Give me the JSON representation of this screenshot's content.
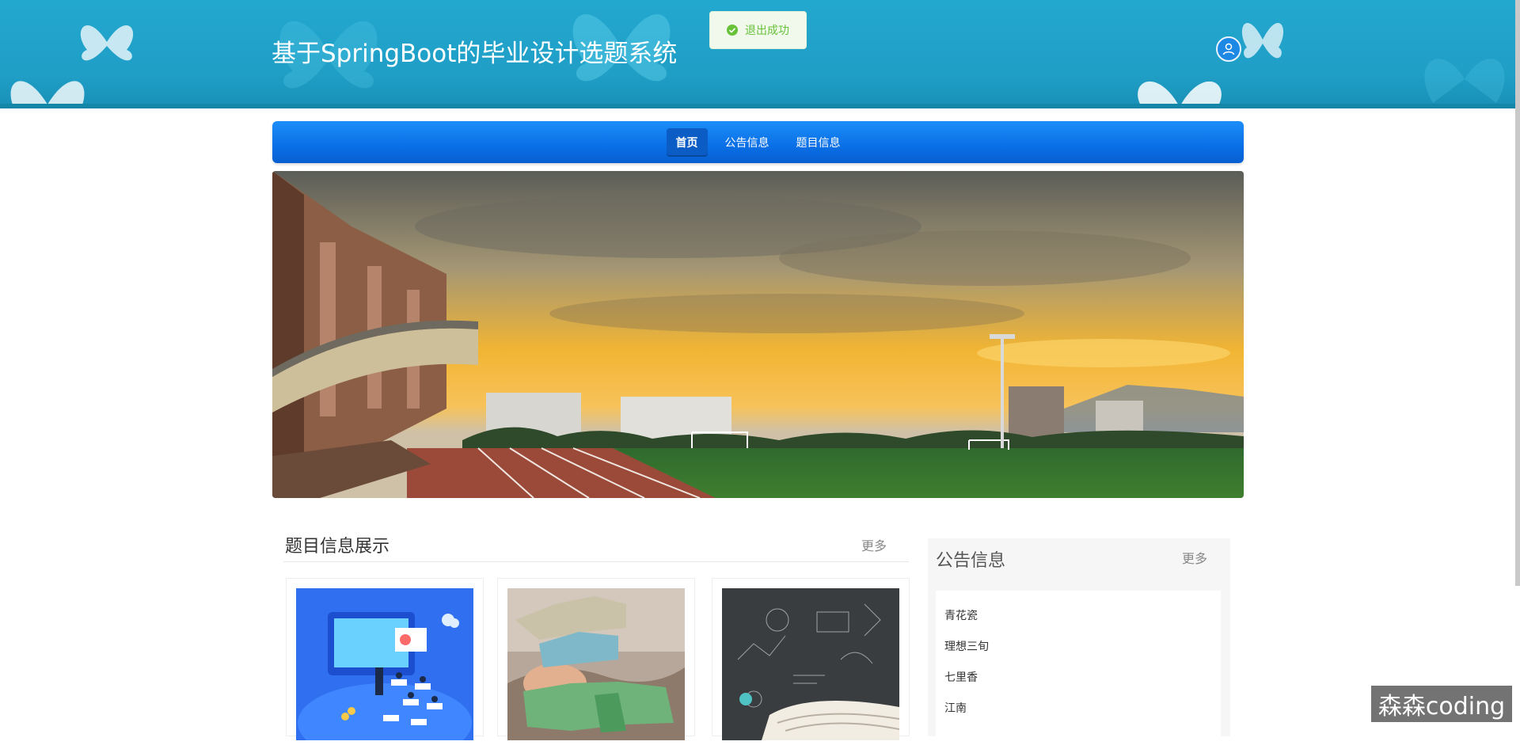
{
  "header": {
    "title": "基于SpringBoot的毕业设计选题系统",
    "avatar_icon": "user-icon"
  },
  "toast": {
    "icon": "check-circle-icon",
    "message": "退出成功"
  },
  "nav": {
    "items": [
      {
        "label": "首页",
        "active": true
      },
      {
        "label": "公告信息",
        "active": false
      },
      {
        "label": "题目信息",
        "active": false
      }
    ]
  },
  "topics": {
    "title": "题目信息展示",
    "more": "更多"
  },
  "notices": {
    "title": "公告信息",
    "more": "更多",
    "items": [
      "青花瓷",
      "理想三旬",
      "七里香",
      "江南"
    ]
  },
  "watermark": "森森coding",
  "colors": {
    "header_bg": "#1fa3cb",
    "nav_bg": "#0a6fe6",
    "toast_bg": "#f0f9eb",
    "toast_text": "#67c23a"
  }
}
